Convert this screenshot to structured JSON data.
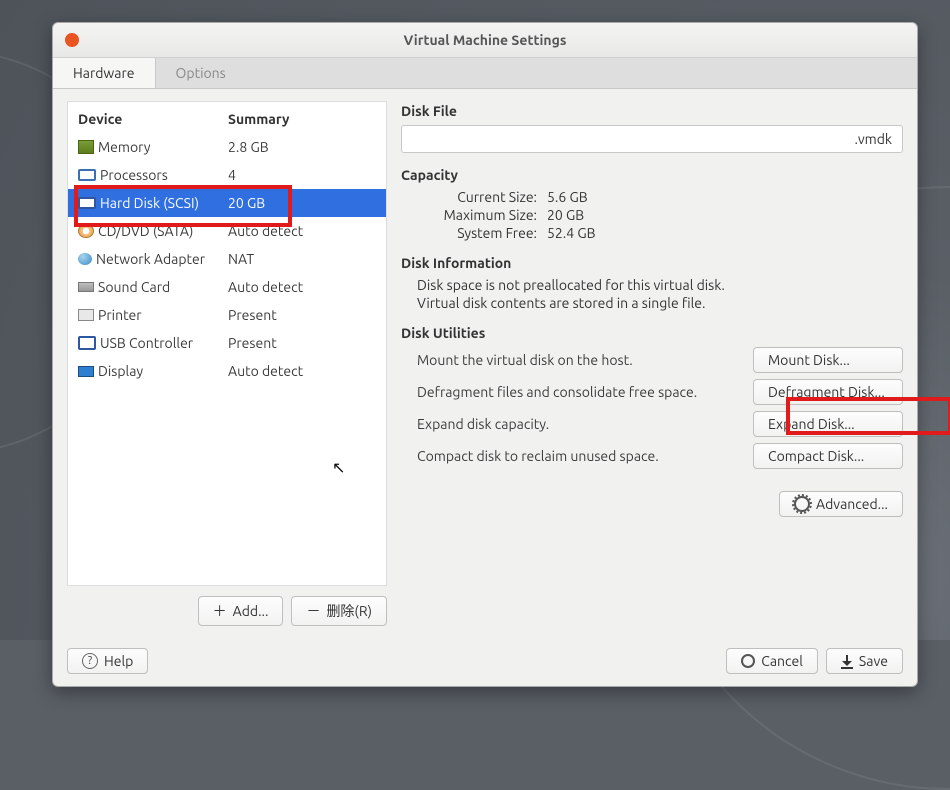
{
  "window": {
    "title": "Virtual Machine Settings"
  },
  "tabs": {
    "hardware": "Hardware",
    "options": "Options"
  },
  "table": {
    "header_device": "Device",
    "header_summary": "Summary",
    "rows": [
      {
        "name": "Memory",
        "summary": "2.8 GB"
      },
      {
        "name": "Processors",
        "summary": "4"
      },
      {
        "name": "Hard Disk (SCSI)",
        "summary": "20 GB"
      },
      {
        "name": "CD/DVD (SATA)",
        "summary": "Auto detect"
      },
      {
        "name": "Network Adapter",
        "summary": "NAT"
      },
      {
        "name": "Sound Card",
        "summary": "Auto detect"
      },
      {
        "name": "Printer",
        "summary": "Present"
      },
      {
        "name": "USB Controller",
        "summary": "Present"
      },
      {
        "name": "Display",
        "summary": "Auto detect"
      }
    ]
  },
  "left_buttons": {
    "add": "Add...",
    "remove": "删除(R)"
  },
  "right": {
    "disk_file_title": "Disk File",
    "disk_file_value": ".vmdk",
    "capacity_title": "Capacity",
    "capacity": {
      "current_k": "Current Size:",
      "current_v": "5.6 GB",
      "max_k": "Maximum Size:",
      "max_v": "20 GB",
      "free_k": "System Free:",
      "free_v": "52.4 GB"
    },
    "info_title": "Disk Information",
    "info_line1": "Disk space is not preallocated for this virtual disk.",
    "info_line2": "Virtual disk contents are stored in a single file.",
    "utils_title": "Disk Utilities",
    "utils": [
      {
        "desc": "Mount the virtual disk on the host.",
        "btn": "Mount Disk..."
      },
      {
        "desc": "Defragment files and consolidate free space.",
        "btn": "Defragment Disk..."
      },
      {
        "desc": "Expand disk capacity.",
        "btn": "Expand Disk..."
      },
      {
        "desc": "Compact disk to reclaim unused space.",
        "btn": "Compact Disk..."
      }
    ],
    "advanced": "Advanced..."
  },
  "footer": {
    "help": "Help",
    "cancel": "Cancel",
    "save": "Save"
  }
}
